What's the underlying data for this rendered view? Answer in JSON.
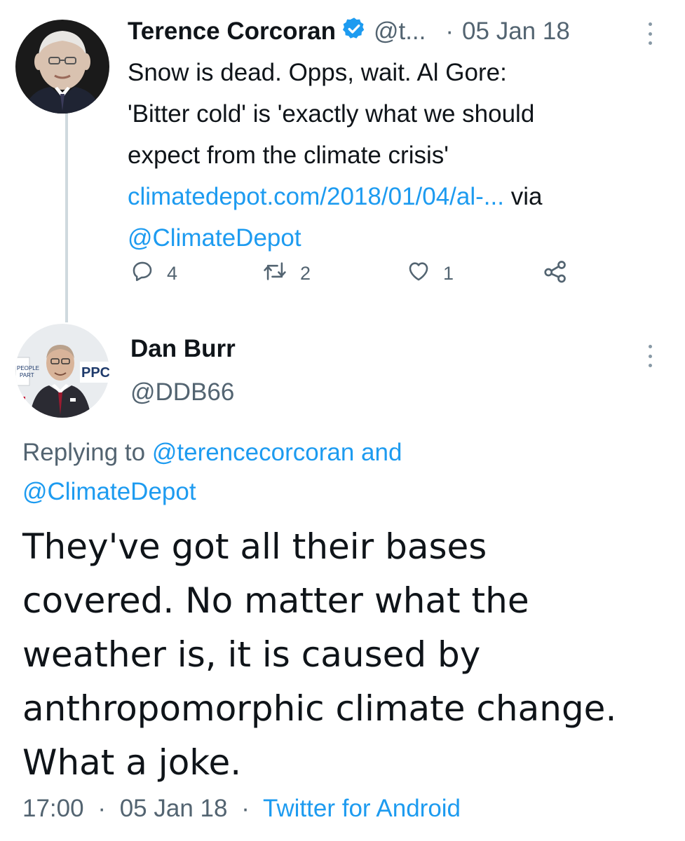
{
  "parent_tweet": {
    "author_name": "Terence Corcoran",
    "handle_truncated": "@t...",
    "separator": "·",
    "date": "05 Jan 18",
    "text_line1": "Snow is dead.  Opps, wait. Al Gore:",
    "text_line2": "'Bitter cold' is 'exactly what we should",
    "text_line3": "expect from the climate crisis'",
    "link": "climatedepot.com/2018/01/04/al-...",
    "via": "via",
    "mention": "@ClimateDepot",
    "reply_count": "4",
    "retweet_count": "2",
    "like_count": "1"
  },
  "reply_tweet": {
    "author_name": "Dan Burr",
    "handle": "@DDB66",
    "replying_prefix": "Replying to",
    "replying_user1": "@terencecorcoran",
    "replying_and": "and",
    "replying_user2": "@ClimateDepot",
    "body_line1": "They've got all their bases",
    "body_line2": "covered. No matter what the",
    "body_line3": "weather is, it is caused by",
    "body_line4": "anthropomorphic climate change.",
    "body_line5": "What a joke.",
    "time": "17:00",
    "date": "05 Jan 18",
    "separator": "·",
    "source": "Twitter for Android"
  },
  "colors": {
    "accent": "#1d9bf0",
    "secondary_text": "#536471",
    "primary_text": "#0f1419",
    "thread_line": "#cfd9de"
  },
  "icons": {
    "verified": "verified-badge-icon",
    "reply": "reply-icon",
    "retweet": "retweet-icon",
    "like": "heart-icon",
    "share": "share-icon",
    "more": "more-options-icon"
  }
}
